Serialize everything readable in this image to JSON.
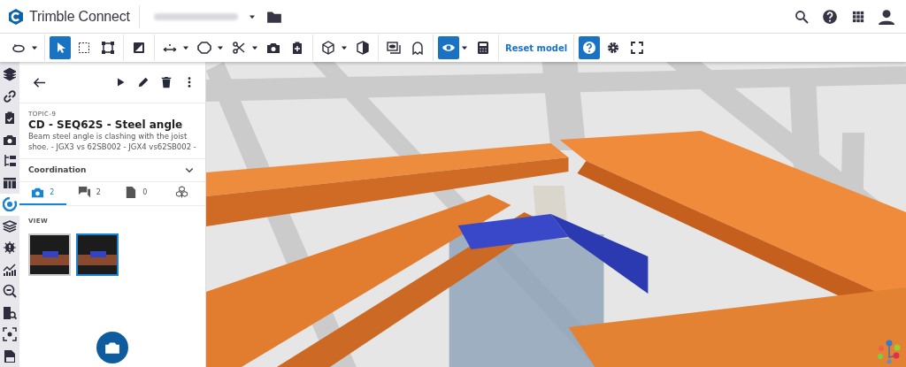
{
  "header": {
    "app_name": "Trimble Connect"
  },
  "toolbar": {
    "groups": [
      [
        {
          "kind": "icon",
          "selected": false,
          "dropdown": true
        }
      ],
      [
        {
          "kind": "icon",
          "selected": true,
          "dropdown": false
        },
        {
          "kind": "icon",
          "selected": false,
          "dropdown": false
        },
        {
          "kind": "icon",
          "selected": false,
          "dropdown": false
        }
      ],
      [
        {
          "kind": "icon",
          "selected": false,
          "dropdown": false
        }
      ],
      [
        {
          "kind": "icon",
          "selected": false,
          "dropdown": true
        },
        {
          "kind": "icon",
          "selected": false,
          "dropdown": true
        },
        {
          "kind": "icon",
          "selected": false,
          "dropdown": true
        },
        {
          "kind": "icon",
          "selected": false,
          "dropdown": false
        },
        {
          "kind": "icon",
          "selected": false,
          "dropdown": false
        }
      ],
      [
        {
          "kind": "icon",
          "selected": false,
          "dropdown": true
        },
        {
          "kind": "icon",
          "selected": false,
          "dropdown": false
        }
      ],
      [
        {
          "kind": "icon",
          "selected": false,
          "dropdown": false
        },
        {
          "kind": "icon",
          "selected": false,
          "dropdown": false
        }
      ],
      [
        {
          "kind": "icon",
          "selected": true,
          "dropdown": true
        },
        {
          "kind": "icon",
          "selected": false,
          "dropdown": false
        }
      ],
      [
        {
          "kind": "text",
          "label": "Reset model",
          "selected": false,
          "dropdown": false
        }
      ],
      [
        {
          "kind": "icon",
          "selected": true,
          "dropdown": false
        },
        {
          "kind": "icon",
          "selected": false,
          "dropdown": false
        },
        {
          "kind": "icon",
          "selected": false,
          "dropdown": false
        }
      ]
    ]
  },
  "sidebar": {
    "items": [
      {
        "selected": false
      },
      {
        "selected": false
      },
      {
        "selected": false
      },
      {
        "selected": false
      },
      {
        "selected": false
      },
      {
        "selected": false
      },
      {
        "selected": true
      },
      {
        "selected": false
      },
      {
        "selected": false
      },
      {
        "selected": false
      },
      {
        "selected": false
      },
      {
        "selected": false
      },
      {
        "selected": false
      },
      {
        "selected": false
      }
    ]
  },
  "topic": {
    "id": "TOPIC-9",
    "title": "CD - SEQ62S - Steel angle",
    "description": "Beam steel angle is clashing with the joist shoe. - JGX3 vs 62SB002 - JGX4 vs62SB002 -",
    "category": "Coordination"
  },
  "tabs": [
    {
      "count": "2",
      "selected": true
    },
    {
      "count": "2",
      "selected": false
    },
    {
      "count": "0",
      "selected": false
    },
    {
      "selected": false
    }
  ],
  "views": {
    "heading": "VIEW",
    "thumbnails": [
      {
        "selected": false
      },
      {
        "selected": true
      }
    ]
  }
}
